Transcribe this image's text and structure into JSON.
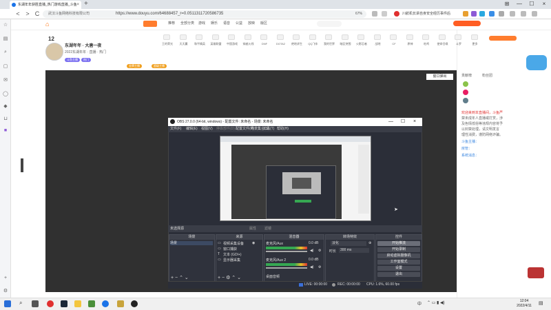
{
  "browser": {
    "tab_title": "东湖年年获胜直播_热门游戏直播_斗鱼",
    "url_prefix": "武汉斗鱼网络科技有限公司",
    "url": "https://www.douyu.com/64688457_r=0.0511311720586735",
    "zoom": "67%",
    "search_hint": "川航机长讲自身安全经历事件后",
    "tab_close": "×",
    "new_tab": "+",
    "back": "<",
    "forward": ">",
    "refresh": "C",
    "home": "⌂"
  },
  "douyu": {
    "nav": [
      "推荐",
      "全部分类",
      "游戏",
      "娱乐",
      "语音",
      "公益",
      "放映",
      "版区"
    ],
    "toolbar": [
      "王的荣光",
      "天天赢",
      "和平精英",
      "英雄联盟",
      "中国游戏",
      "穿越火线",
      "DNF",
      "DOTA2",
      "绝地求生",
      "QQ飞车",
      "我的世界",
      "暗区突围",
      "火影忍者",
      "战地",
      "CF",
      "原神",
      "吃鸡",
      "使命召唤",
      "斗罗",
      "更多"
    ],
    "level": "12",
    "room_name": "东湖年年 · 大唐一夜",
    "room_sub": "2022东湖年年 · 直播 · 热门",
    "badges": [
      "斗鱼主播",
      "热门",
      "金牌主播",
      "超级主播"
    ],
    "popout": "窗口弹出",
    "right_tags": [
      "贡献榜",
      "粉丝团"
    ],
    "chat": [
      "欢迎来到本直播间，斗鱼严",
      "禁未成年人直播或打赏，涉",
      "及色情低俗等违规内容将予",
      "以封禁处理，请文明发言",
      "理性消费，谨防网络诈骗。",
      "斗鱼主播：",
      "房管：",
      "系统消息："
    ]
  },
  "obs": {
    "title": "OBS 27.0.0 (64-bit, windows) - 配置文件: 未命名 - 场景: 未命名",
    "menu": [
      "文件(F)",
      "编辑(E)",
      "视图(V)",
      "停靠部件(D)",
      "配置文件(P)",
      "场景集合(S)",
      "工具(T)",
      "帮助(H)"
    ],
    "no_source": "未选择源",
    "props": "属性",
    "filters": "滤镜",
    "docks": {
      "scenes": {
        "title": "场景",
        "items": [
          "场景"
        ]
      },
      "sources": {
        "title": "来源",
        "items": [
          "视频采集设备",
          "窗口捕获",
          "文本 (GDI+)",
          "显示器采集"
        ]
      },
      "mixer": {
        "title": "混音器",
        "tracks": [
          "麦克风/Aux",
          "麦克风/Aux 2",
          "桌面音频"
        ],
        "db": "0.0 dB"
      },
      "transitions": {
        "title": "转场特效",
        "type": "淡化",
        "duration_label": "时长",
        "duration": "300 ms"
      },
      "controls": {
        "title": "控件",
        "buttons": [
          "开始推流",
          "开始录制",
          "启动虚拟摄像机",
          "工作室模式",
          "设置",
          "退出"
        ]
      }
    },
    "status": {
      "live": "LIVE: 00:00:00",
      "rec": "REC: 00:00:00",
      "cpu": "CPU: 1.6%, 60.00 fps"
    }
  },
  "taskbar": {
    "time": "12:04",
    "date": "2022/4/11",
    "lang": "中"
  }
}
